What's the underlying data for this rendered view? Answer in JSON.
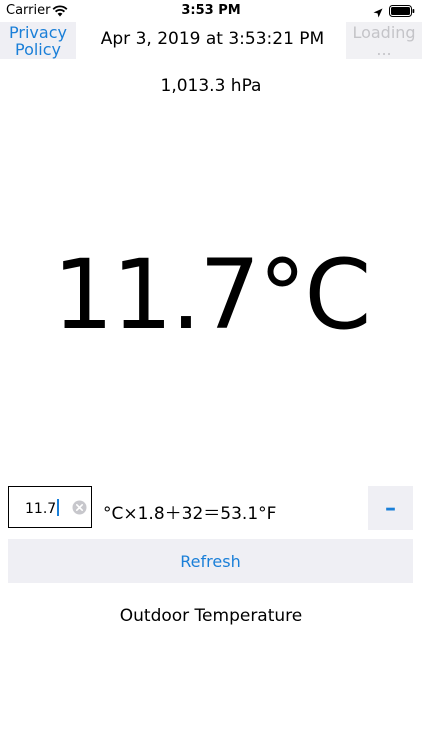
{
  "status_bar": {
    "carrier": "Carrier",
    "time": "3:53 PM",
    "icons": [
      "wifi-icon",
      "location-arrow-icon",
      "battery-icon"
    ]
  },
  "header": {
    "privacy_label": "Privacy Policy",
    "datetime": "Apr 3, 2019 at 3:53:21 PM",
    "loading_label": "Loading ..."
  },
  "pressure": "1,013.3 hPa",
  "temperature": "11.7°C",
  "converter": {
    "input_value": "11.7",
    "formula": "°C×1.8＋32＝53.1°F",
    "toggle_label": "–"
  },
  "refresh_label": "Refresh",
  "caption": "Outdoor Temperature",
  "colors": {
    "accent": "#1a7fd8",
    "button_bg": "#efeff4",
    "disabled_text": "#c4c4c8"
  }
}
